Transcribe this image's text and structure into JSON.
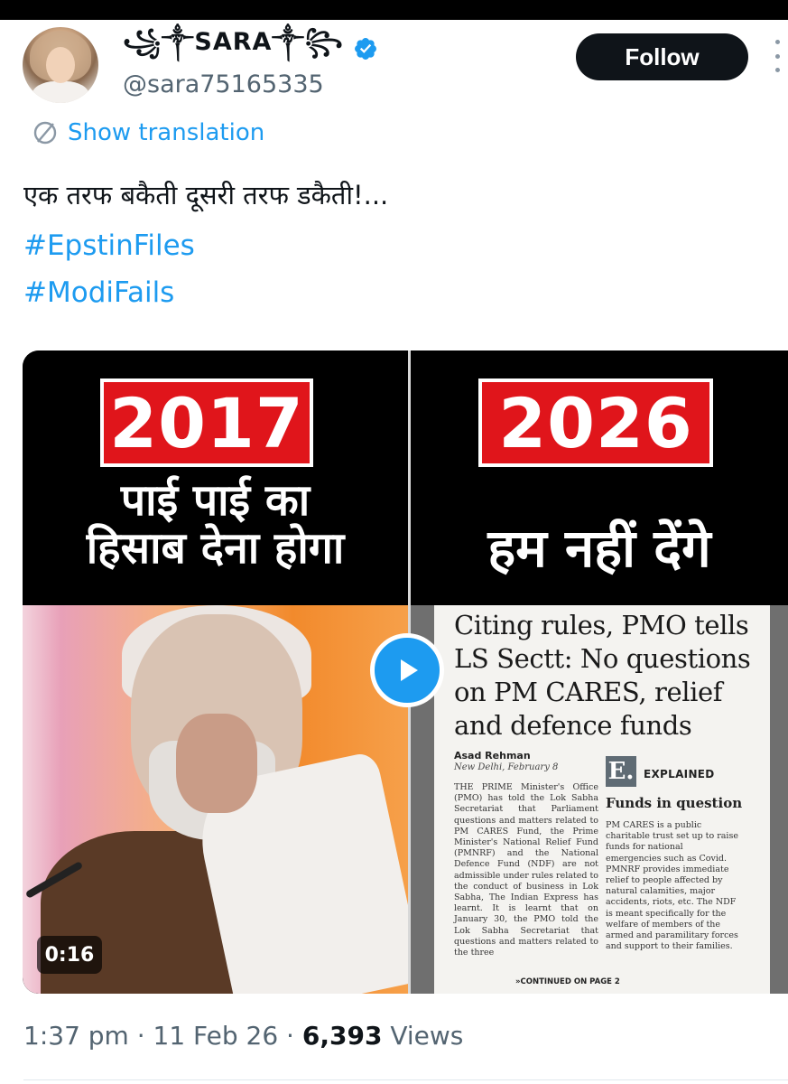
{
  "author": {
    "display_name": "꧁༒SARA༒꧂",
    "handle": "@sara75165335",
    "verified_icon": "verified-badge-icon"
  },
  "actions": {
    "follow_label": "Follow",
    "more_icon": "more-vertical-icon"
  },
  "translation": {
    "label": "Show translation",
    "icon": "translate-icon"
  },
  "tweet": {
    "text": "एक तरफ बकैती दूसरी तरफ डकैती!...",
    "hashtags": [
      "#EpstinFiles",
      "#ModiFails"
    ]
  },
  "media": {
    "left_year": "2017",
    "left_caption_line1": "पाई पाई का",
    "left_caption_line2": "हिसाब देना होगा",
    "right_year": "2026",
    "right_caption": "हम नहीं देंगे",
    "duration": "0:16",
    "play_icon": "play-icon",
    "newspaper": {
      "headline": "Citing rules, PMO tells LS Sectt: No questions on PM CARES, relief and defence funds",
      "author": "Asad Rehman",
      "dateline": "New Delhi, February 8",
      "body": "THE PRIME Minister's Office (PMO) has told the Lok Sabha Secretariat that Parliament questions and matters related to PM CARES Fund, the Prime Minister's National Relief Fund (PMNRF) and the National Defence Fund (NDF) are not admissible under rules related to the conduct of business in Lok Sabha, The Indian Express has learnt. It is learnt that on January 30, the PMO told the Lok Sabha Secretariat that questions and matters related to the three",
      "continued": "»CONTINUED ON PAGE 2",
      "e_logo": "E.",
      "explained_label": "EXPLAINED",
      "sidebar_title": "Funds in question",
      "sidebar_body": "PM CARES is a public charitable trust set up to raise funds for national emergencies such as Covid. PMNRF provides immediate relief to people affected by natural calamities, major accidents, riots, etc. The NDF is meant specifically for the welfare of members of the armed and paramilitary forces and support to their families."
    }
  },
  "meta": {
    "time_date": "1:37 pm · 11 Feb 26 · ",
    "views_count": "6,393",
    "views_label": " Views"
  },
  "colors": {
    "accent": "#1d9bf0",
    "text": "#0f1419",
    "muted": "#536471",
    "year_red": "#e0151b"
  }
}
